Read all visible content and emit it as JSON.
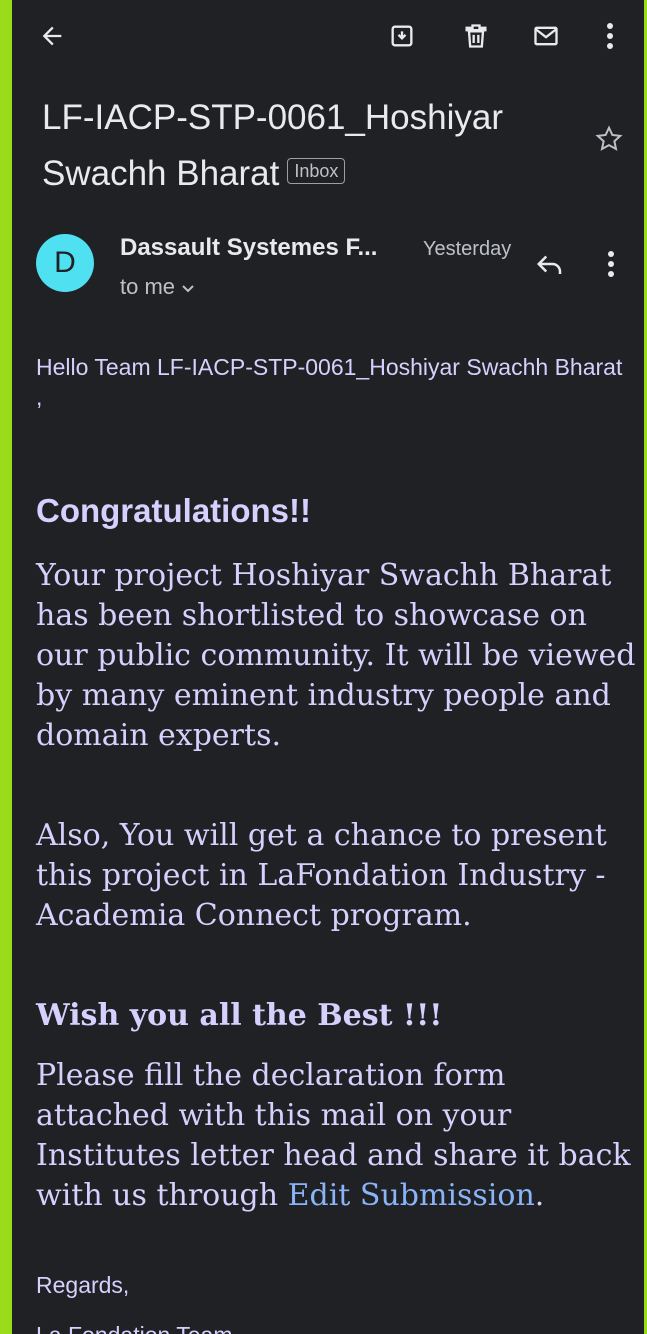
{
  "toolbar": {
    "back_icon": "arrow-back-icon",
    "archive_icon": "archive-icon",
    "delete_icon": "trash-icon",
    "mark_unread_icon": "mail-icon",
    "more_icon": "more-vert-icon"
  },
  "email": {
    "subject": "LF-IACP-STP-0061_Hoshiyar Swachh Bharat",
    "label": "Inbox",
    "sender_initial": "D",
    "sender_name": "Dassault Systemes F...",
    "time": "Yesterday",
    "recipient": "to me",
    "greeting": "Hello Team LF-IACP-STP-0061_Hoshiyar Swachh Bharat ,",
    "heading": "Congratulations!!",
    "paragraph1": "Your project Hoshiyar Swachh Bharat has been shortlisted to showcase on our public community. It will be viewed by many eminent industry people and domain experts.",
    "paragraph2": "Also, You will get a chance to present this project in LaFondation Industry - Academia Connect program.",
    "wish": "Wish you all the Best !!!",
    "paragraph3_prefix": "Please fill the declaration form attached with this mail on your Institutes letter head and share it back with us through ",
    "paragraph3_link": "Edit Submission",
    "paragraph3_suffix": ".",
    "regards": "Regards,",
    "signature": "La Fondation Team"
  },
  "colors": {
    "background": "#202124",
    "frame": "#9bdc1a",
    "avatar": "#4fe0f2",
    "body_text": "#d6d0ff",
    "link": "#8ab4f8"
  }
}
